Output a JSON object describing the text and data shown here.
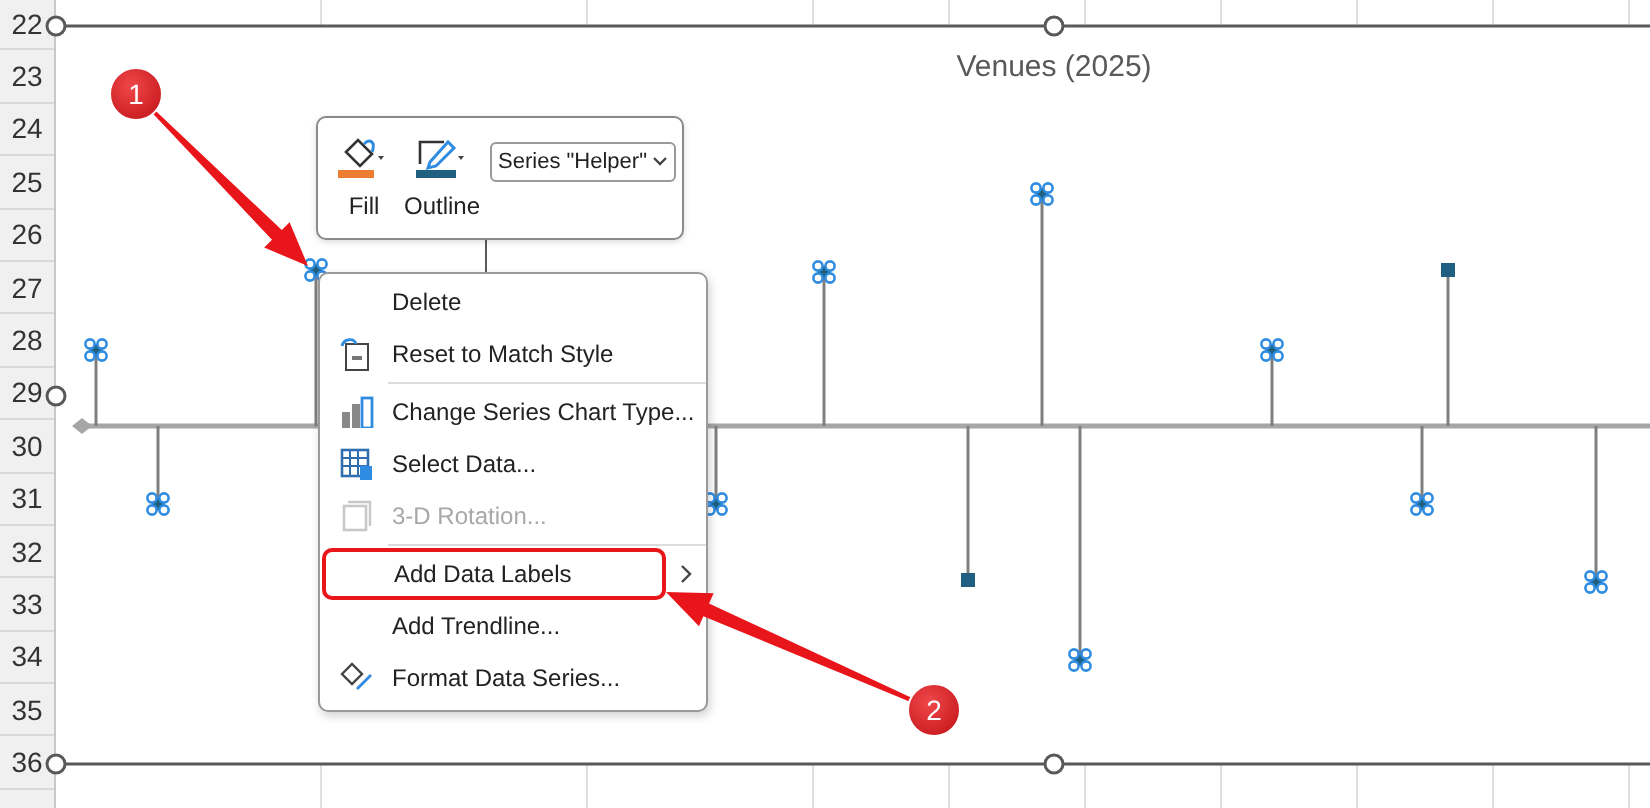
{
  "sheet": {
    "row_numbers": [
      "22",
      "23",
      "24",
      "25",
      "26",
      "27",
      "28",
      "29",
      "30",
      "31",
      "32",
      "33",
      "34",
      "35",
      "36"
    ]
  },
  "chart": {
    "title": "Venues (2025)",
    "selected": true,
    "points": [
      {
        "selected": true
      },
      {
        "selected": true
      },
      {
        "selected": true
      },
      {
        "selected": true
      },
      {
        "selected": true
      },
      {
        "selected": false
      },
      {
        "selected": true
      },
      {
        "selected": true
      },
      {
        "selected": true
      },
      {
        "selected": true
      },
      {
        "selected": false
      },
      {
        "selected": true
      }
    ]
  },
  "mini_toolbar": {
    "buttons": [
      {
        "label": "Fill",
        "kind": "fill",
        "color": "#ed7d31"
      },
      {
        "label": "Outline",
        "kind": "outline",
        "color": "#1f5f80"
      }
    ],
    "series_dropdown": "Series \"Helper\""
  },
  "context_menu": {
    "items": [
      {
        "kind": "item",
        "label": "Delete",
        "disabled": false,
        "highlighted": false
      },
      {
        "kind": "item",
        "label": "Reset to Match Style",
        "disabled": false,
        "highlighted": false
      },
      {
        "kind": "separator"
      },
      {
        "kind": "item",
        "label": "Change Series Chart Type...",
        "disabled": false,
        "highlighted": false
      },
      {
        "kind": "item",
        "label": "Select Data...",
        "disabled": false,
        "highlighted": false
      },
      {
        "kind": "item",
        "label": "3-D Rotation...",
        "disabled": true,
        "highlighted": false
      },
      {
        "kind": "separator"
      },
      {
        "kind": "item",
        "label": "Add Data Labels",
        "disabled": false,
        "highlighted": true,
        "submenu": true
      },
      {
        "kind": "item",
        "label": "Add Trendline...",
        "disabled": false,
        "highlighted": false
      },
      {
        "kind": "item",
        "label": "Format Data Series...",
        "disabled": false,
        "highlighted": false
      }
    ]
  },
  "callouts": [
    {
      "number": "1"
    },
    {
      "number": "2"
    }
  ]
}
